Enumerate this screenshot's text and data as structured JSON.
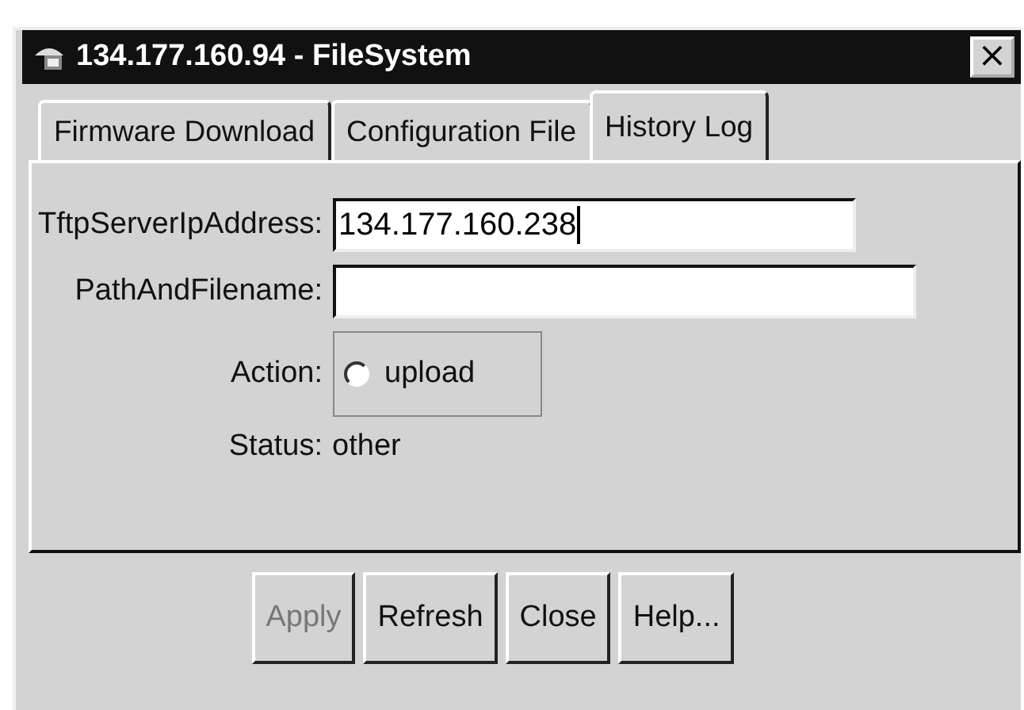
{
  "window": {
    "title": "134.177.160.94 - FileSystem",
    "close_glyph": "×"
  },
  "tabs": [
    {
      "label": "Firmware Download",
      "selected": false
    },
    {
      "label": "Configuration File",
      "selected": false
    },
    {
      "label": "History Log",
      "selected": true
    }
  ],
  "form": {
    "tftp_label": "TftpServerIpAddress:",
    "tftp_value": "134.177.160.238",
    "path_label": "PathAndFilename:",
    "action_label": "Action:",
    "action_option": {
      "label": "upload",
      "selected": false
    },
    "status_label": "Status:",
    "status_value": "other"
  },
  "buttons": [
    {
      "label": "Apply",
      "disabled": true
    },
    {
      "label": "Refresh",
      "disabled": false
    },
    {
      "label": "Close",
      "disabled": false
    },
    {
      "label": "Help...",
      "disabled": false
    }
  ]
}
